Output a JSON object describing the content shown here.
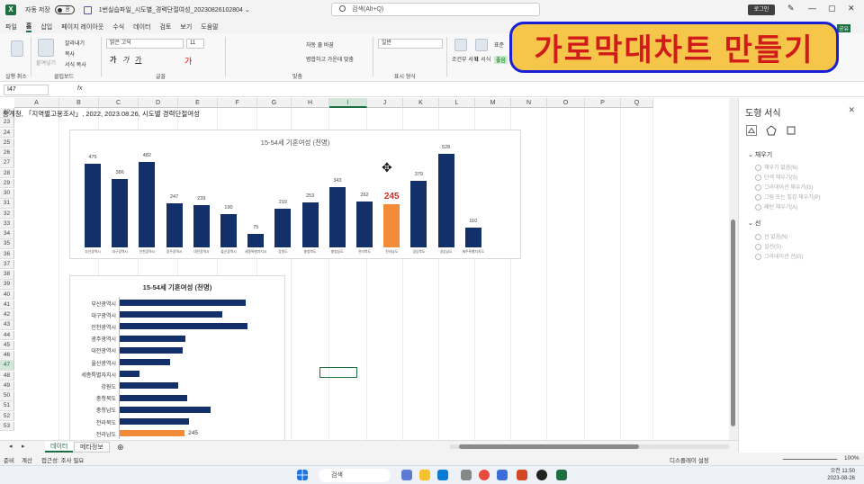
{
  "titlebar": {
    "autosave": "자동 저장",
    "toggle": "끔",
    "filename": "1번실습파일_시도별_경력단절여성_20230826102804 ⌄",
    "search": "검색(Alt+Q)",
    "login": "로그인"
  },
  "menu": [
    "파일",
    "홈",
    "삽입",
    "페이지 레이아웃",
    "수식",
    "데이터",
    "검토",
    "보기",
    "도움말"
  ],
  "ribbon": {
    "undo": "실행 취소",
    "clipboard": "클립보드",
    "paste": "붙여넣기",
    "cut": "잘라내기",
    "copy": "복사",
    "format_painter": "서식 복사",
    "font_group": "글꼴",
    "font_name": "맑은 고딕",
    "font_size": "11",
    "align_group": "맞춤",
    "wrap": "자동 줄 바꿈",
    "merge": "병합하고 가운데 맞춤",
    "number_group": "표시 형식",
    "number_format": "일반",
    "cond_format": "조건부 서식",
    "table_format": "표 서식",
    "style_normal": "표준",
    "style_good": "좋음",
    "comment": "메모",
    "share": "공유",
    "fill_group": "채우기"
  },
  "banner": "가로막대차트 만들기",
  "formula": {
    "namebox": "I47",
    "fx": "fx"
  },
  "columns": [
    "A",
    "B",
    "C",
    "D",
    "E",
    "F",
    "G",
    "H",
    "I",
    "J",
    "K",
    "L",
    "M",
    "N",
    "O",
    "P",
    "Q"
  ],
  "rows": [
    "22",
    "23",
    "24",
    "25",
    "26",
    "27",
    "28",
    "29",
    "30",
    "31",
    "32",
    "33",
    "34",
    "35",
    "36",
    "37",
    "38",
    "39",
    "40",
    "41",
    "42",
    "43",
    "44",
    "45",
    "46",
    "47",
    "48",
    "49",
    "50",
    "51",
    "52",
    "53"
  ],
  "source_text": "통계청, 「지역별고용조사」, 2022, 2023.08.26, 시도별 경력단절여성",
  "chart_data": [
    {
      "type": "bar",
      "title": "15-54세 기혼여성 (천명)",
      "categories": [
        "부산광역시",
        "대구광역시",
        "인천광역시",
        "광주광역시",
        "대전광역시",
        "울산광역시",
        "세종특별자치시",
        "강원도",
        "충청북도",
        "충청남도",
        "전라북도",
        "전라남도",
        "경상북도",
        "경상남도",
        "제주특별자치도"
      ],
      "values": [
        475,
        386,
        482,
        247,
        239,
        190,
        75,
        219,
        253,
        343,
        262,
        245,
        379,
        528,
        110
      ],
      "highlight": "전라남도",
      "highlight_color": "#f28c38",
      "bar_color": "#14306a",
      "ylim": [
        0,
        560
      ]
    },
    {
      "type": "bar",
      "orientation": "horizontal",
      "title": "15-54세 기혼여성 (천명)",
      "categories": [
        "부산광역시",
        "대구광역시",
        "인천광역시",
        "광주광역시",
        "대전광역시",
        "울산광역시",
        "세종특별자치시",
        "강원도",
        "충청북도",
        "충청남도",
        "전라북도",
        "전라남도"
      ],
      "values": [
        475,
        386,
        482,
        247,
        239,
        190,
        75,
        219,
        253,
        343,
        262,
        245
      ],
      "highlight": "전라남도",
      "highlight_label": "245",
      "highlight_color": "#f28c38",
      "bar_color": "#14306a"
    }
  ],
  "sheets": [
    "데이터",
    "메타정보"
  ],
  "status": {
    "ready": "준비",
    "calc": "계산",
    "access": "접근성: 조사 필요",
    "display": "디스플레이 설정",
    "zoom": "100%"
  },
  "pane": {
    "title": "도형 서식",
    "fill": "채우기",
    "fill_opts": [
      "채우기 없음(N)",
      "단색 채우기(S)",
      "그라데이션 채우기(G)",
      "그림 또는 질감 채우기(P)",
      "패턴 채우기(A)"
    ],
    "line": "선",
    "line_opts": [
      "선 없음(N)",
      "실선(S)",
      "그라데이션 선(G)"
    ]
  },
  "taskbar": {
    "search": "검색",
    "time": "오전 11:50",
    "date": "2023-08-26"
  }
}
